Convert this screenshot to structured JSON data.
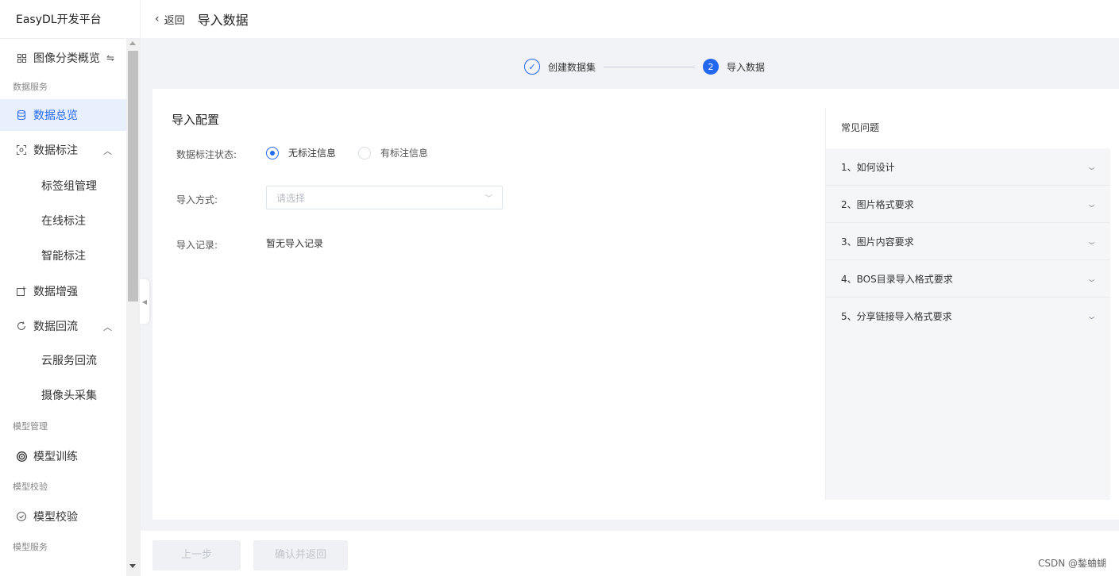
{
  "app": {
    "brand": "EasyDL开发平台"
  },
  "header": {
    "back_label": "返回",
    "title": "导入数据"
  },
  "sidebar": {
    "overview": "图像分类概览",
    "groups": {
      "data_service": "数据服务",
      "model_manage": "模型管理",
      "model_verify": "模型校验",
      "model_service": "模型服务"
    },
    "items": {
      "data_overview": "数据总览",
      "data_annotation": "数据标注",
      "label_group": "标签组管理",
      "online_annotation": "在线标注",
      "smart_annotation": "智能标注",
      "data_augment": "数据增强",
      "data_backflow": "数据回流",
      "cloud_backflow": "云服务回流",
      "camera_collect": "摄像头采集",
      "model_train": "模型训练",
      "model_verify": "模型校验"
    }
  },
  "steps": [
    {
      "label": "创建数据集",
      "state": "done"
    },
    {
      "label": "导入数据",
      "number": "2",
      "state": "current"
    }
  ],
  "form": {
    "section_title": "导入配置",
    "annotation_status_label": "数据标注状态:",
    "annotation_options": [
      "无标注信息",
      "有标注信息"
    ],
    "annotation_selected": "无标注信息",
    "import_method_label": "导入方式:",
    "import_method_placeholder": "请选择",
    "import_record_label": "导入记录:",
    "import_record_value": "暂无导入记录"
  },
  "faq": {
    "title": "常见问题",
    "items": [
      "1、如何设计",
      "2、图片格式要求",
      "3、图片内容要求",
      "4、BOS目录导入格式要求",
      "5、分享链接导入格式要求"
    ]
  },
  "footer": {
    "prev_label": "上一步",
    "confirm_label": "确认并返回"
  },
  "watermark": "CSDN @鍫蛐蝴",
  "colors": {
    "accent": "#2468f2",
    "active_bg": "#e8f0fd",
    "page_bg": "#f2f3f6"
  },
  "icons": [
    "grid-icon",
    "switch-icon",
    "database-icon",
    "scan-icon",
    "augment-icon",
    "refresh-icon",
    "target-icon",
    "check-circle-icon"
  ]
}
